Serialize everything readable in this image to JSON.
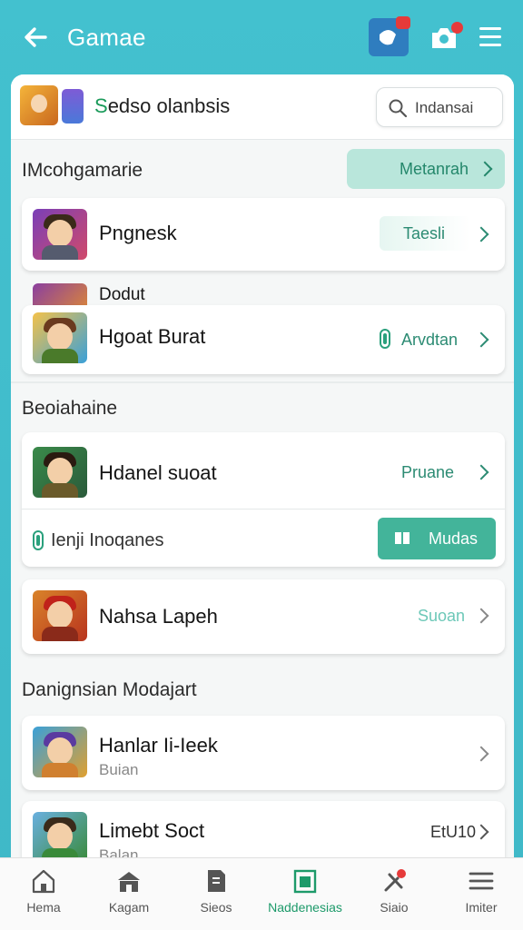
{
  "app": {
    "title": "Gamae",
    "back_icon": "arrow-left-icon",
    "notification_icon": "notification-icon",
    "camera_icon": "camera-icon",
    "menu_icon": "menu-icon"
  },
  "header": {
    "title_green": "S",
    "title_rest": "edso olanbsis",
    "search_placeholder": "Indansai"
  },
  "section1": {
    "title": "IMcohgamarie",
    "button_label": "Metanrah"
  },
  "rows": [
    {
      "name": "Pngnesk",
      "action": "Taesli",
      "action_style": "pill"
    },
    {
      "name": "Dodut",
      "action": "",
      "action_style": "none"
    },
    {
      "name": "Hgoat Burat",
      "action": "Arvdtan",
      "action_style": "toggle"
    }
  ],
  "section2": {
    "title": "Beoiahaine",
    "rows": [
      {
        "name": "Hdanel suoat",
        "action": "Pruane"
      }
    ],
    "toggle_row": {
      "label": "Ienji Inoqanes",
      "button_label": "Mudas"
    },
    "rows_after": [
      {
        "name": "Nahsa Lapeh",
        "action": "Suoan"
      }
    ]
  },
  "section3": {
    "title": "Danignsian Modajart",
    "rows": [
      {
        "name": "Hanlar Ii-Ieek",
        "sub": "Buian",
        "action": ""
      },
      {
        "name": "Limebt Soct",
        "sub": "Balan",
        "action": "EtU10"
      }
    ]
  },
  "bottom_nav": [
    {
      "label": "Hema",
      "icon": "home-icon"
    },
    {
      "label": "Kagam",
      "icon": "shop-icon"
    },
    {
      "label": "Sieos",
      "icon": "document-icon"
    },
    {
      "label": "Naddenesias",
      "icon": "store-icon",
      "active": true
    },
    {
      "label": "Siaio",
      "icon": "tools-icon"
    },
    {
      "label": "Imiter",
      "icon": "list-menu-icon"
    }
  ],
  "colors": {
    "background": "#43c1cf",
    "accent": "#1d9a6a",
    "badge_red": "#e63a3a"
  }
}
